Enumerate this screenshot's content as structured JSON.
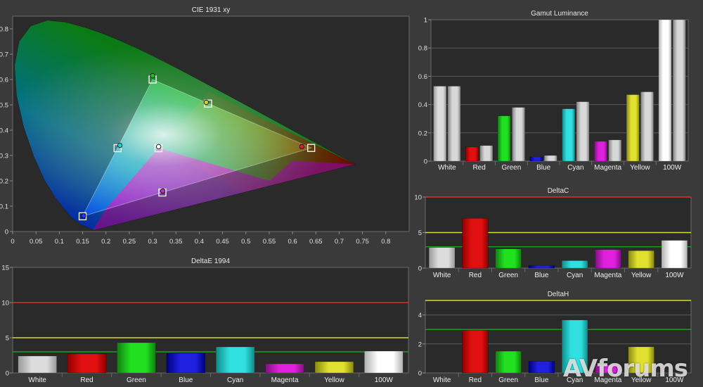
{
  "watermark": "AVforums",
  "chart_data": [
    {
      "id": "cie",
      "type": "scatter",
      "title": "CIE 1931 xy",
      "xlim": [
        0,
        0.85
      ],
      "ylim": [
        0,
        0.85
      ],
      "xticks": [
        "0",
        "0.05",
        "0.1",
        "0.15",
        "0.2",
        "0.25",
        "0.3",
        "0.35",
        "0.4",
        "0.45",
        "0.5",
        "0.55",
        "0.6",
        "0.65",
        "0.7",
        "0.75",
        "0.8"
      ],
      "yticks": [
        "0",
        "0.1",
        "0.2",
        "0.3",
        "0.4",
        "0.5",
        "0.6",
        "0.7",
        "0.8"
      ],
      "targets": [
        {
          "name": "Red",
          "x": 0.64,
          "y": 0.33
        },
        {
          "name": "Green",
          "x": 0.3,
          "y": 0.6
        },
        {
          "name": "Blue",
          "x": 0.15,
          "y": 0.06
        },
        {
          "name": "White",
          "x": 0.3127,
          "y": 0.329
        },
        {
          "name": "Cyan",
          "x": 0.225,
          "y": 0.329
        },
        {
          "name": "Magenta",
          "x": 0.321,
          "y": 0.154
        },
        {
          "name": "Yellow",
          "x": 0.419,
          "y": 0.505
        }
      ],
      "measured": [
        {
          "name": "Red",
          "x": 0.62,
          "y": 0.335,
          "color": "#e02020"
        },
        {
          "name": "Green",
          "x": 0.3,
          "y": 0.615,
          "color": "#20c020"
        },
        {
          "name": "Blue",
          "x": 0.152,
          "y": 0.062,
          "color": "#3030ff"
        },
        {
          "name": "White",
          "x": 0.313,
          "y": 0.335,
          "color": "#ffffff"
        },
        {
          "name": "Cyan",
          "x": 0.23,
          "y": 0.34,
          "color": "#20d0d0"
        },
        {
          "name": "Magenta",
          "x": 0.322,
          "y": 0.16,
          "color": "#d020d0"
        },
        {
          "name": "Yellow",
          "x": 0.415,
          "y": 0.51,
          "color": "#d0d020"
        }
      ]
    },
    {
      "id": "lum",
      "type": "bar",
      "title": "Gamut Luminance",
      "categories": [
        "White",
        "Red",
        "Green",
        "Blue",
        "Cyan",
        "Magenta",
        "Yellow",
        "100W"
      ],
      "ylim": [
        0,
        1
      ],
      "yticks": [
        "0",
        "0.2",
        "0.4",
        "0.6",
        "0.8",
        "1"
      ],
      "series": [
        {
          "values": [
            0.53,
            0.1,
            0.32,
            0.03,
            0.37,
            0.14,
            0.47,
            1.0
          ]
        },
        {
          "values": [
            0.53,
            0.11,
            0.38,
            0.04,
            0.42,
            0.15,
            0.49,
            1.0
          ]
        }
      ]
    },
    {
      "id": "dc",
      "type": "bar",
      "title": "DeltaC",
      "categories": [
        "White",
        "Red",
        "Green",
        "Blue",
        "Cyan",
        "Magenta",
        "Yellow",
        "100W"
      ],
      "ylim": [
        0,
        10
      ],
      "yticks": [
        "0",
        "5",
        "10"
      ],
      "series": [
        {
          "values": [
            2.9,
            7.0,
            2.7,
            0.35,
            1.05,
            2.6,
            2.45,
            3.9
          ]
        }
      ],
      "reference_lines": [
        {
          "y": 10,
          "color": "#e03030"
        },
        {
          "y": 5,
          "color": "#d8d830"
        },
        {
          "y": 3,
          "color": "#20a020"
        }
      ]
    },
    {
      "id": "de",
      "type": "bar",
      "title": "DeltaE 1994",
      "categories": [
        "White",
        "Red",
        "Green",
        "Blue",
        "Cyan",
        "Magenta",
        "Yellow",
        "100W"
      ],
      "ylim": [
        0,
        15
      ],
      "yticks": [
        "0",
        "5",
        "10",
        "15"
      ],
      "series": [
        {
          "values": [
            2.4,
            2.7,
            4.3,
            2.8,
            3.7,
            1.3,
            1.6,
            3.1
          ]
        }
      ],
      "reference_lines": [
        {
          "y": 10,
          "color": "#e03030"
        },
        {
          "y": 5,
          "color": "#d8d830"
        },
        {
          "y": 3,
          "color": "#20a020"
        }
      ]
    },
    {
      "id": "dh",
      "type": "bar",
      "title": "DeltaH",
      "categories": [
        "White",
        "Red",
        "Green",
        "Blue",
        "Cyan",
        "Magenta",
        "Yellow",
        "100W"
      ],
      "ylim": [
        0,
        5
      ],
      "yticks": [
        "0",
        "2",
        "4"
      ],
      "series": [
        {
          "values": [
            0,
            2.95,
            1.5,
            0.8,
            3.65,
            0.55,
            1.8,
            0
          ]
        }
      ],
      "reference_lines": [
        {
          "y": 5,
          "color": "#d8d830"
        },
        {
          "y": 3,
          "color": "#20a020"
        }
      ]
    }
  ],
  "bar_colors": {
    "White": [
      "#dcdcdc",
      "#999999"
    ],
    "Red": [
      "#e01010",
      "#900000"
    ],
    "Green": [
      "#20e020",
      "#108010"
    ],
    "Blue": [
      "#2020e0",
      "#000080"
    ],
    "Cyan": [
      "#30e0e0",
      "#108a8a"
    ],
    "Magenta": [
      "#e020e0",
      "#801080"
    ],
    "Yellow": [
      "#e0e030",
      "#888810"
    ],
    "100W": [
      "#ffffff",
      "#b0b0b0"
    ],
    "ref": [
      "#d8d8d8",
      "#808080"
    ]
  }
}
